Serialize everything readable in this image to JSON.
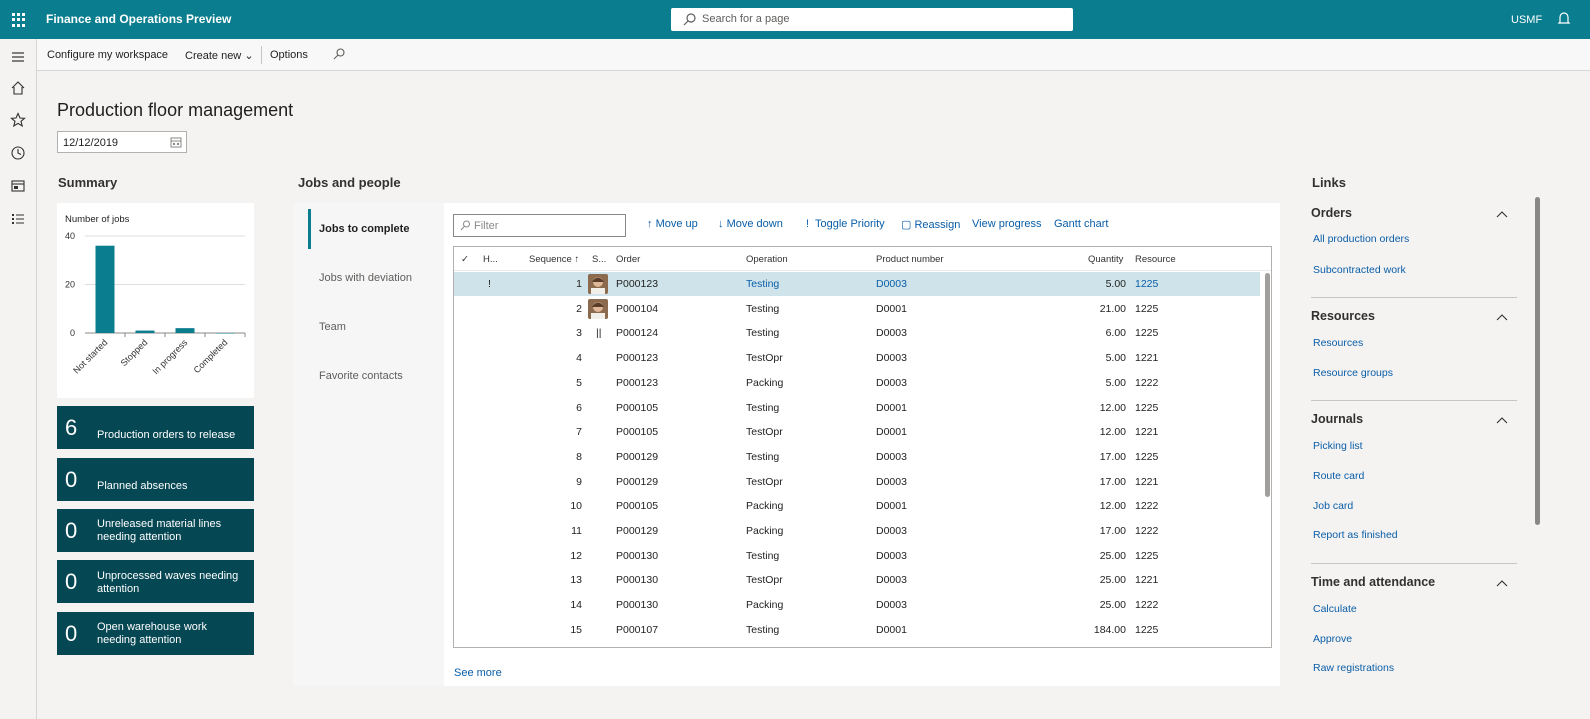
{
  "app": {
    "title": "Finance and Operations Preview",
    "search_placeholder": "Search for a page",
    "company": "USMF"
  },
  "actionbar": {
    "configure": "Configure my workspace",
    "create_new": "Create new",
    "options": "Options"
  },
  "page": {
    "title": "Production floor management",
    "date": "12/12/2019"
  },
  "summary": {
    "title": "Summary",
    "tiles": [
      {
        "count": "6",
        "label": "Production orders to release"
      },
      {
        "count": "0",
        "label": "Planned absences"
      },
      {
        "count": "0",
        "label": "Unreleased material lines needing attention"
      },
      {
        "count": "0",
        "label": "Unprocessed waves needing attention"
      },
      {
        "count": "0",
        "label": "Open warehouse work needing attention"
      }
    ]
  },
  "chart_data": {
    "type": "bar",
    "title": "Number of jobs",
    "categories": [
      "Not started",
      "Stopped",
      "In progress",
      "Completed"
    ],
    "values": [
      36,
      1,
      2,
      0
    ],
    "ylim": [
      0,
      40
    ],
    "yticks": [
      "0",
      "20",
      "40"
    ],
    "color": "#0a7d8e",
    "grid": true
  },
  "jobs": {
    "title": "Jobs and people",
    "tabs": [
      "Jobs to complete",
      "Jobs with deviation",
      "Team",
      "Favorite contacts"
    ],
    "filter_placeholder": "Filter",
    "toolbar": {
      "move_up": "Move up",
      "move_down": "Move down",
      "toggle_priority": "Toggle Priority",
      "reassign": "Reassign",
      "view_progress": "View progress",
      "gantt": "Gantt chart"
    },
    "columns": {
      "h": "H...",
      "sequence": "Sequence",
      "s": "S...",
      "order": "Order",
      "operation": "Operation",
      "product": "Product number",
      "quantity": "Quantity",
      "resource": "Resource"
    },
    "rows": [
      {
        "h": "!",
        "seq": "1",
        "status": "",
        "order": "P000123",
        "op": "Testing",
        "product": "D0003",
        "qty": "5.00",
        "res": "1225"
      },
      {
        "h": "",
        "seq": "2",
        "status": "",
        "order": "P000104",
        "op": "Testing",
        "product": "D0001",
        "qty": "21.00",
        "res": "1225"
      },
      {
        "h": "",
        "seq": "3",
        "status": "||",
        "order": "P000124",
        "op": "Testing",
        "product": "D0003",
        "qty": "6.00",
        "res": "1225"
      },
      {
        "h": "",
        "seq": "4",
        "status": "",
        "order": "P000123",
        "op": "TestOpr",
        "product": "D0003",
        "qty": "5.00",
        "res": "1221"
      },
      {
        "h": "",
        "seq": "5",
        "status": "",
        "order": "P000123",
        "op": "Packing",
        "product": "D0003",
        "qty": "5.00",
        "res": "1222"
      },
      {
        "h": "",
        "seq": "6",
        "status": "",
        "order": "P000105",
        "op": "Testing",
        "product": "D0001",
        "qty": "12.00",
        "res": "1225"
      },
      {
        "h": "",
        "seq": "7",
        "status": "",
        "order": "P000105",
        "op": "TestOpr",
        "product": "D0001",
        "qty": "12.00",
        "res": "1221"
      },
      {
        "h": "",
        "seq": "8",
        "status": "",
        "order": "P000129",
        "op": "Testing",
        "product": "D0003",
        "qty": "17.00",
        "res": "1225"
      },
      {
        "h": "",
        "seq": "9",
        "status": "",
        "order": "P000129",
        "op": "TestOpr",
        "product": "D0003",
        "qty": "17.00",
        "res": "1221"
      },
      {
        "h": "",
        "seq": "10",
        "status": "",
        "order": "P000105",
        "op": "Packing",
        "product": "D0001",
        "qty": "12.00",
        "res": "1222"
      },
      {
        "h": "",
        "seq": "11",
        "status": "",
        "order": "P000129",
        "op": "Packing",
        "product": "D0003",
        "qty": "17.00",
        "res": "1222"
      },
      {
        "h": "",
        "seq": "12",
        "status": "",
        "order": "P000130",
        "op": "Testing",
        "product": "D0003",
        "qty": "25.00",
        "res": "1225"
      },
      {
        "h": "",
        "seq": "13",
        "status": "",
        "order": "P000130",
        "op": "TestOpr",
        "product": "D0003",
        "qty": "25.00",
        "res": "1221"
      },
      {
        "h": "",
        "seq": "14",
        "status": "",
        "order": "P000130",
        "op": "Packing",
        "product": "D0003",
        "qty": "25.00",
        "res": "1222"
      },
      {
        "h": "",
        "seq": "15",
        "status": "",
        "order": "P000107",
        "op": "Testing",
        "product": "D0001",
        "qty": "184.00",
        "res": "1225"
      }
    ],
    "see_more": "See more"
  },
  "links": {
    "title": "Links",
    "groups": [
      {
        "title": "Orders",
        "items": [
          "All production orders",
          "Subcontracted work"
        ]
      },
      {
        "title": "Resources",
        "items": [
          "Resources",
          "Resource groups"
        ]
      },
      {
        "title": "Journals",
        "items": [
          "Picking list",
          "Route card",
          "Job card",
          "Report as finished"
        ]
      },
      {
        "title": "Time and attendance",
        "items": [
          "Calculate",
          "Approve",
          "Raw registrations"
        ]
      }
    ]
  }
}
